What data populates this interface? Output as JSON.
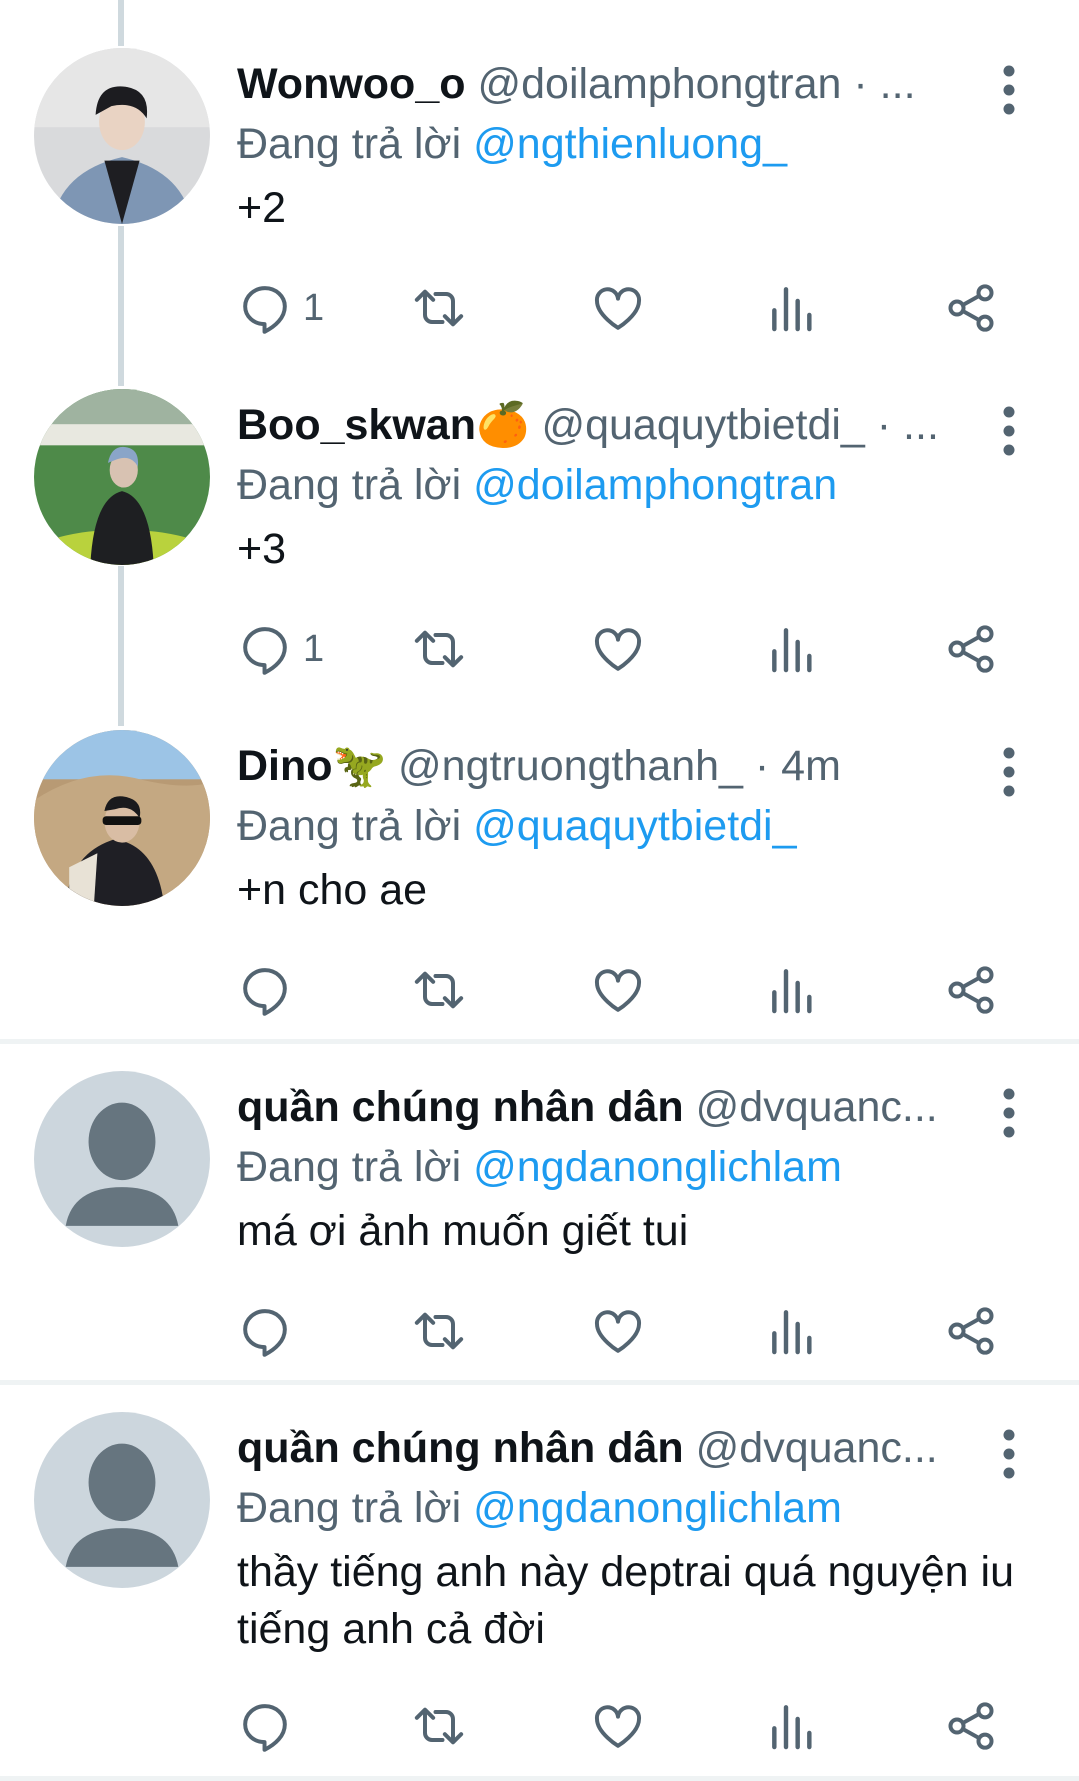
{
  "replying_prefix": "Đang trả lời",
  "colors": {
    "accent": "#1d9bf0",
    "text": "#0f1419",
    "secondary_text": "#536471",
    "thread_line": "#cfd9de",
    "divider": "#eff3f4"
  },
  "action_icons": [
    "reply-icon",
    "retweet-icon",
    "like-icon",
    "views-icon",
    "share-icon"
  ],
  "tweets": [
    {
      "display_name": "Wonwoo_o",
      "handle_meta": "@doilamphongtran · ...",
      "replying_to": "@ngthienluong_",
      "text": "+2",
      "reply_count": "1"
    },
    {
      "display_name": "Boo_skwan🍊",
      "handle_meta": "@quaquytbietdi_ · ...",
      "replying_to": "@doilamphongtran",
      "text": "+3",
      "reply_count": "1"
    },
    {
      "display_name": "Dino🦖",
      "handle_meta": "@ngtruongthanh_ · 4m",
      "replying_to": "@quaquytbietdi_",
      "text": "+n cho ae",
      "reply_count": ""
    },
    {
      "display_name": "quần chúng nhân dân",
      "handle_meta": "@dvquanc...",
      "replying_to": "@ngdanonglichlam",
      "text": "má ơi ảnh muốn giết tui",
      "reply_count": ""
    },
    {
      "display_name": "quần chúng nhân dân",
      "handle_meta": "@dvquanc...",
      "replying_to": "@ngdanonglichlam",
      "text": "thầy tiếng anh này deptrai quá nguyện iu tiếng anh cả đời",
      "reply_count": ""
    }
  ]
}
